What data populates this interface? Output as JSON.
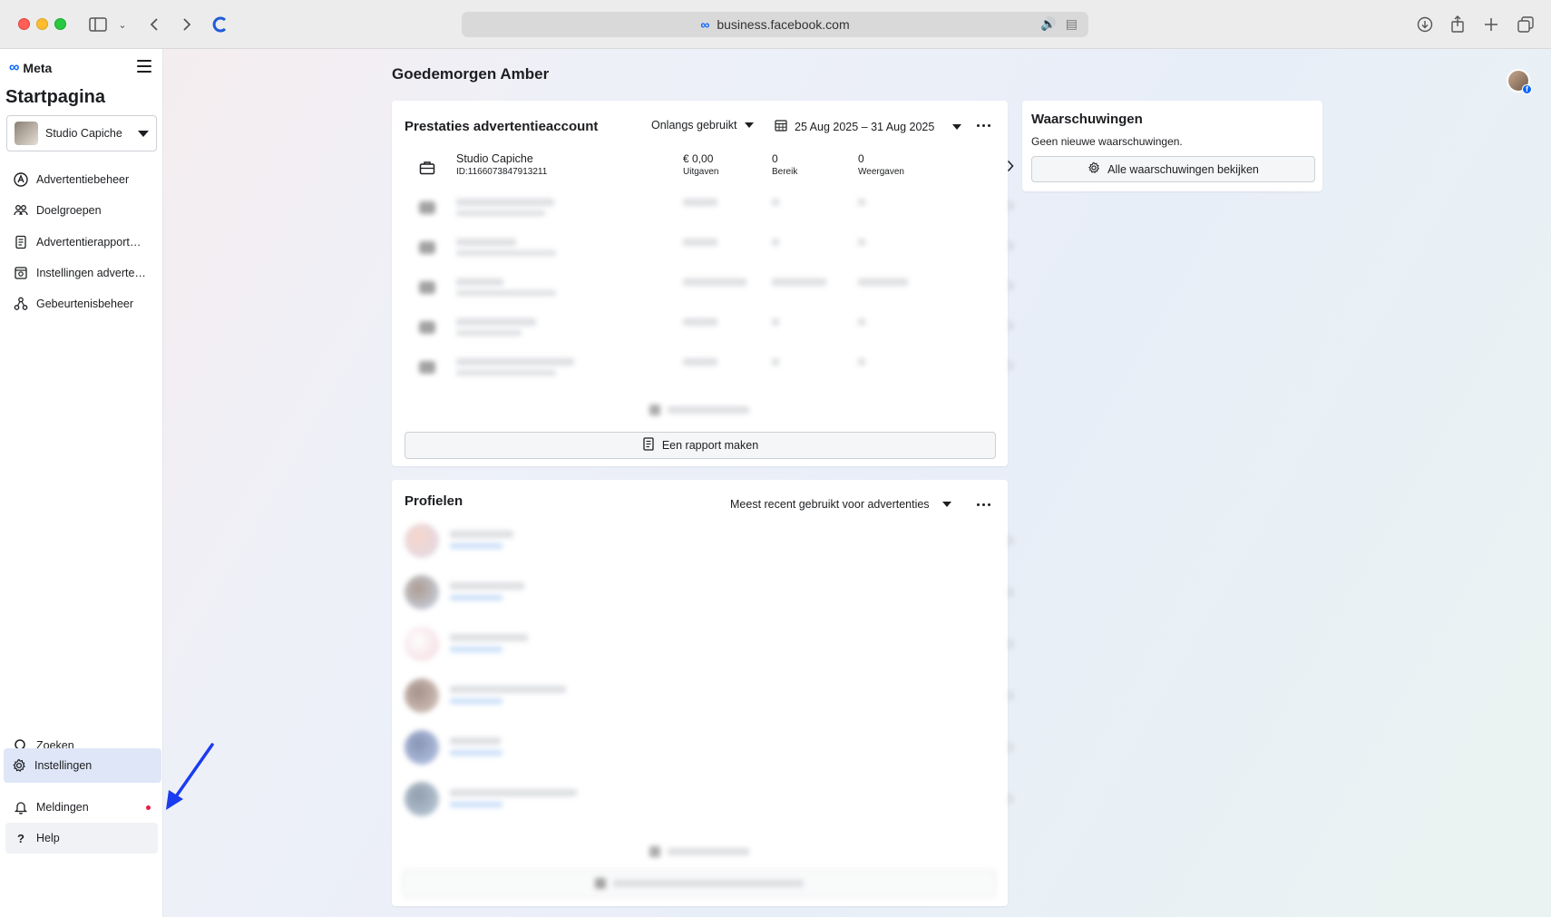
{
  "browser": {
    "url": "business.facebook.com"
  },
  "sidebar": {
    "brand": "Meta",
    "title": "Startpagina",
    "account": "Studio Capiche",
    "items": [
      {
        "label": "Advertentiebeheer",
        "icon": "ads-manager-icon"
      },
      {
        "label": "Doelgroepen",
        "icon": "audiences-icon"
      },
      {
        "label": "Advertentierapport…",
        "icon": "ad-reports-icon"
      },
      {
        "label": "Instellingen adverte…",
        "icon": "ad-settings-icon"
      },
      {
        "label": "Gebeurtenisbeheer",
        "icon": "events-manager-icon"
      }
    ],
    "bottom": {
      "search": "Zoeken",
      "settings": "Instellingen",
      "notifications": "Meldingen",
      "help": "Help"
    }
  },
  "main": {
    "greeting": "Goedemorgen Amber",
    "performance": {
      "title": "Prestaties advertentieaccount",
      "filter": "Onlangs gebruikt",
      "date_range": "25 Aug 2025 – 31 Aug 2025",
      "account": {
        "name": "Studio Capiche",
        "id": "ID:1166073847913211",
        "spend_value": "€ 0,00",
        "spend_label": "Uitgaven",
        "reach_value": "0",
        "reach_label": "Bereik",
        "impressions_value": "0",
        "impressions_label": "Weergaven"
      },
      "report_button": "Een rapport maken"
    },
    "profiles": {
      "title": "Profielen",
      "filter": "Meest recent gebruikt voor advertenties"
    },
    "warnings": {
      "title": "Waarschuwingen",
      "text": "Geen nieuwe waarschuwingen.",
      "button": "Alle waarschuwingen bekijken"
    }
  },
  "colors": {
    "accent": "#0866ff",
    "annotation_arrow": "#1a3cf0",
    "active_nav_bg": "#dfe6f7",
    "notification_dot": "#e41e3f"
  }
}
